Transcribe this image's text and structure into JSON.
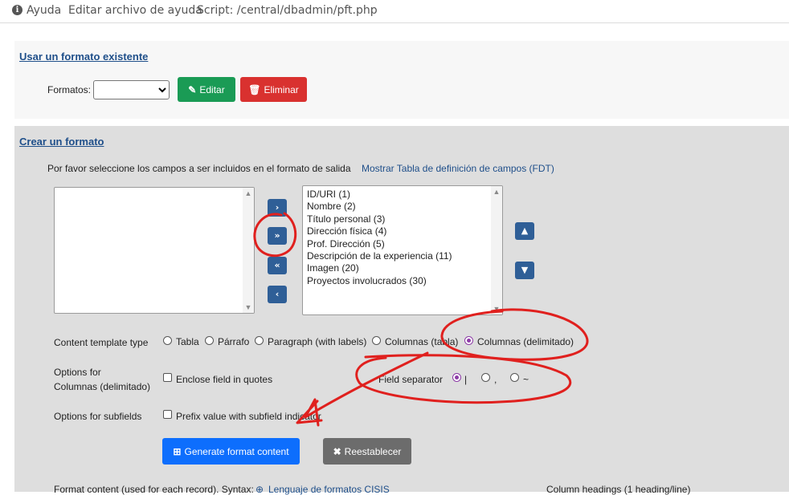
{
  "topbar": {
    "help": "Ayuda",
    "edit_help": "Editar archivo de ayuda",
    "script": "Script: /central/dbadmin/pft.php"
  },
  "existing": {
    "title": "Usar un formato existente",
    "formats_label": "Formatos:",
    "formats_value": "",
    "edit_label": "Editar",
    "delete_label": "Eliminar"
  },
  "create": {
    "title": "Crear un formato",
    "instructions": "Por favor seleccione los campos a ser incluidos en el formato de salida",
    "fdt_link": "Mostrar Tabla de definición de campos (FDT)",
    "fields": [
      "ID/URI (1)",
      "Nombre (2)",
      "Título personal (3)",
      "Dirección física (4)",
      "Prof. Dirección (5)",
      "Descripción de la experiencia (11)",
      "Imagen (20)",
      "Proyectos involucrados (30)"
    ],
    "template_type_label": "Content template type",
    "template_options": [
      "Tabla",
      "Párrafo",
      "Paragraph (with labels)",
      "Columnas (tabla)",
      "Columnas (delimitado)"
    ],
    "options_delim_label_1": "Options for",
    "options_delim_label_2": "Columnas (delimitado)",
    "enclose_label": "Enclose field in quotes",
    "separator_label": "Field separator",
    "separator_options": [
      "|",
      ",",
      "~"
    ],
    "subfields_label": "Options for subfields",
    "prefix_label": "Prefix value with subfield indicator",
    "generate_label": "Generate format content",
    "reset_label": "Reestablecer",
    "format_content_label": "Format content (used for each record). Syntax:",
    "cisis_link": "Lenguaje de formatos CISIS",
    "column_headings_label": "Column headings (1 heading/line)"
  },
  "colors": {
    "accent": "#8c3ba6",
    "annotation": "#e0201e"
  }
}
